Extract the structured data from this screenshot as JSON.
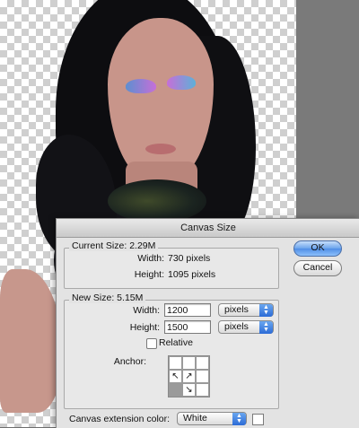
{
  "dialog": {
    "title": "Canvas Size",
    "current_size": {
      "title": "Current Size: 2.29M",
      "width_label": "Width:",
      "width_value": "730 pixels",
      "height_label": "Height:",
      "height_value": "1095 pixels"
    },
    "new_size": {
      "title": "New Size: 5.15M",
      "width_label": "Width:",
      "width_value": "1200",
      "width_unit": "pixels",
      "height_label": "Height:",
      "height_value": "1500",
      "height_unit": "pixels",
      "relative_label": "Relative",
      "relative_checked": false,
      "anchor_label": "Anchor:",
      "anchor_cells": [
        "",
        "",
        "",
        "↖",
        "↗",
        "",
        "",
        "↘",
        ""
      ]
    },
    "extension": {
      "label": "Canvas extension color:",
      "value": "White",
      "swatch_color": "#ffffff"
    },
    "buttons": {
      "ok": "OK",
      "cancel": "Cancel"
    }
  },
  "icons": {
    "select_arrows": "up-down-chevron-icon"
  }
}
